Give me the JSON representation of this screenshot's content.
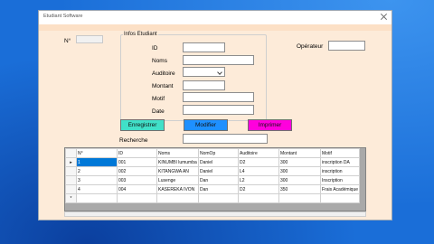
{
  "window": {
    "title": "Etudiant Software"
  },
  "header": {
    "number_label": "N°",
    "operator_label": "Opérateur"
  },
  "form": {
    "group_title": "Infos Etudiant",
    "labels": {
      "id": "ID",
      "noms": "Noms",
      "auditoire": "Auditoire",
      "montant": "Montant",
      "motif": "Motif",
      "date": "Date"
    }
  },
  "buttons": {
    "save": {
      "label": "Enregistrer",
      "color": "#40e0c8"
    },
    "edit": {
      "label": "Modifier",
      "color": "#1e90ff"
    },
    "print": {
      "label": "Imprimer",
      "color": "#ff00dd"
    }
  },
  "search": {
    "label": "Recherche"
  },
  "table": {
    "columns": [
      "N°",
      "ID",
      "Noms",
      "NomOp",
      "Auditoire",
      "Montant",
      "Motif"
    ],
    "rows": [
      [
        "1",
        "001",
        "KINUMBI lumumba",
        "Daniel",
        "D2",
        "300",
        "inscription DA"
      ],
      [
        "2",
        "002",
        "KITANGWA AN",
        "Daniel",
        "L4",
        "300",
        "inscription"
      ],
      [
        "3",
        "003",
        "Lusenge",
        "Dan",
        "L2",
        "300",
        "Inscription"
      ],
      [
        "4",
        "004",
        "KASEREKA IVON",
        "Dan",
        "D2",
        "350",
        "Frais Académique"
      ]
    ],
    "selected_row": 0
  }
}
